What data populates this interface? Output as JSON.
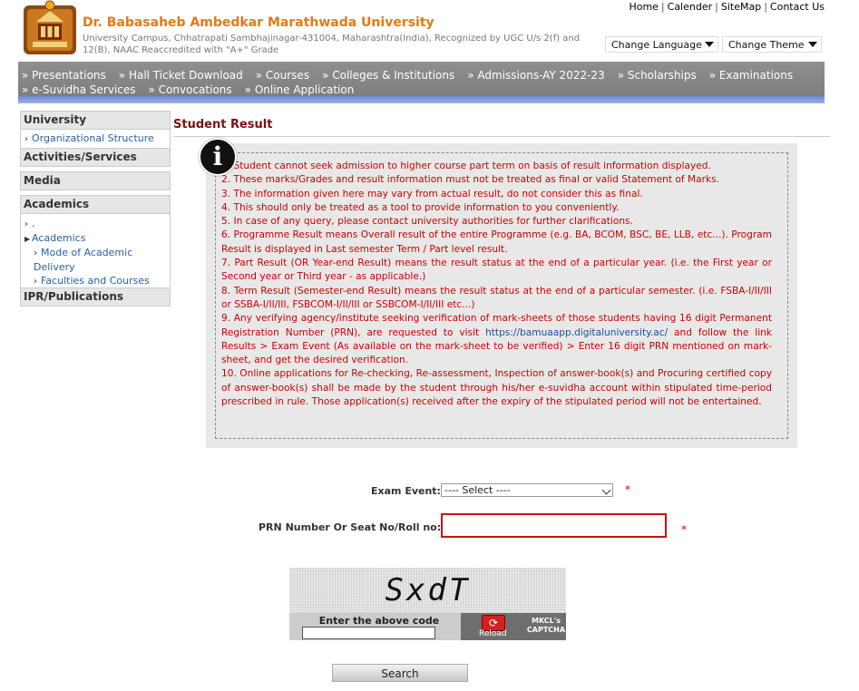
{
  "header": {
    "title": "Dr. Babasaheb Ambedkar Marathwada University",
    "subtitle": "University Campus, Chhatrapati Sambhajinagar-431004, Maharashtra(India), Recognized by UGC U/s 2(f) and 12(B), NAAC Reaccredited with \"A+\" Grade",
    "top_links": [
      "Home",
      "Calender",
      "SiteMap",
      "Contact Us"
    ],
    "change_language": "Change Language",
    "change_theme": "Change Theme"
  },
  "nav": {
    "items": [
      "Presentations",
      "Hall Ticket Download",
      "Courses",
      "Colleges & Institutions",
      "Admissions-AY 2022-23",
      "Scholarships",
      "Examinations",
      "e-Suvidha Services",
      "Convocations",
      "Online Application"
    ]
  },
  "sidebar": {
    "university": "University",
    "org_structure": "Organizational Structure",
    "activities": "Activities/Services",
    "media": "Media",
    "academics": "Academics",
    "dot": ".",
    "academics_link": "Academics",
    "mode_delivery": "Mode of Academic Delivery",
    "faculties": "Faculties and Courses",
    "ipr": "IPR/Publications"
  },
  "main": {
    "title": "Student Result",
    "info_icon": "i",
    "notes": [
      "1. Student cannot seek admission to higher course part term on basis of result information displayed.",
      "2. These marks/Grades and result information must not be treated as final or valid Statement of Marks.",
      "3. The information given here may vary from actual result, do not consider this as final.",
      "4. This should only be treated as a tool to provide information to you conveniently.",
      "5. In case of any query, please contact university authorities for further clarifications.",
      "6. Programme Result means Overall result of the entire Programme (e.g. BA, BCOM, BSC, BE, LLB, etc...). Program Result is displayed in Last semester Term / Part level result.",
      "7. Part Result (OR Year-end Result) means the result status at the end of a particular year. (i.e. the First year or Second year or Third year - as applicable.)",
      "8. Term Result (Semester-end Result) means the result status at the end of a particular semester. (i.e. FSBA-I/II/III or SSBA-I/II/III, FSBCOM-I/II/III or SSBCOM-I/II/III etc...)"
    ],
    "note9_a": "9. Any verifying agency/institute seeking verification of mark-sheets of those students having 16 digit Permanent Registration Number (PRN), are requested to visit",
    "note9_link": "https://bamuaapp.digitaluniversity.ac/",
    "note9_b": "and follow the link Results > Exam Event (As available on the mark-sheet to be verified) > Enter 16 digit PRN mentioned on mark-sheet, and get the desired verification.",
    "note10": "10. Online applications for Re-checking, Re-assessment, Inspection of answer-book(s) and Procuring certified copy of answer-book(s) shall be made by the student through his/her e-suvidha account within stipulated time-period prescribed in rule. Those application(s) received after the expiry of the stipulated period will not be entertained."
  },
  "form": {
    "exam_event_label": "Exam Event:",
    "exam_event_value": "---- Select ----",
    "prn_label": "PRN Number Or Seat No/Roll no:",
    "prn_value": "",
    "required": "*",
    "captcha_text": "SxdT",
    "captcha_prompt": "Enter the above code",
    "reload": "Reload",
    "captcha_brand": "MKCL's CAPTCHA",
    "search": "Search"
  }
}
